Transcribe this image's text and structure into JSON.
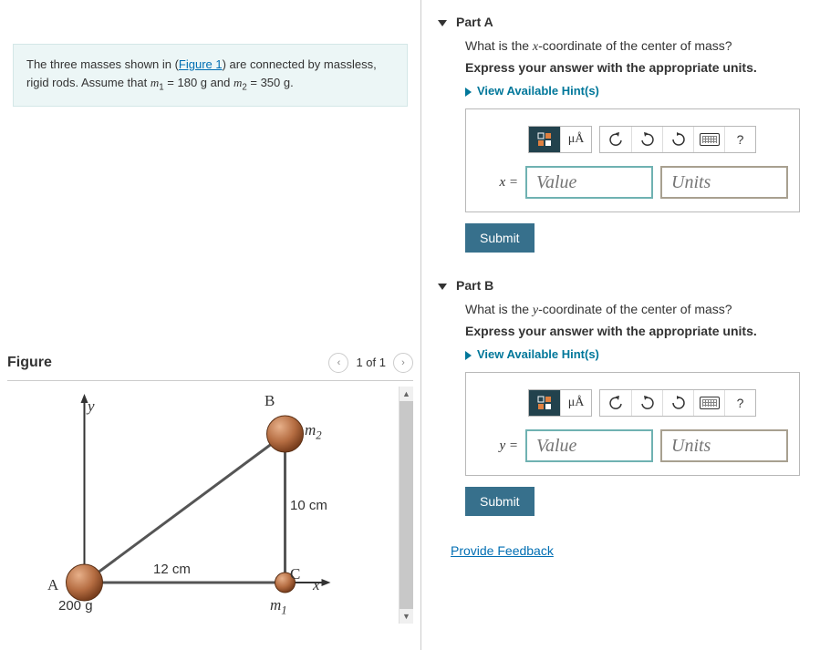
{
  "problem": {
    "prefix": "The three masses shown in (",
    "figureLink": "Figure 1",
    "middle": ") are connected by massless, rigid rods. Assume that ",
    "m1label": "m",
    "m1sub": "1",
    "m1eq": " = 180 g and ",
    "m2label": "m",
    "m2sub": "2",
    "m2eq": " = 350 g."
  },
  "figure": {
    "title": "Figure",
    "pager": "1 of 1",
    "labels": {
      "y": "y",
      "x": "x",
      "A": "A",
      "B": "B",
      "C": "C",
      "m1": "m",
      "m1sub": "1",
      "m2": "m",
      "m2sub": "2",
      "massA": "200 g",
      "sideAC": "12 cm",
      "sideBC": "10 cm"
    }
  },
  "partA": {
    "header": "Part A",
    "question": "What is the x-coordinate of the center of mass?",
    "instruction": "Express your answer with the appropriate units.",
    "hints": "View Available Hint(s)",
    "mu": "μÅ",
    "help": "?",
    "varLabel": "x =",
    "valuePlaceholder": "Value",
    "unitsPlaceholder": "Units",
    "submit": "Submit"
  },
  "partB": {
    "header": "Part B",
    "question": "What is the y-coordinate of the center of mass?",
    "instruction": "Express your answer with the appropriate units.",
    "hints": "View Available Hint(s)",
    "mu": "μÅ",
    "help": "?",
    "varLabel": "y =",
    "valuePlaceholder": "Value",
    "unitsPlaceholder": "Units",
    "submit": "Submit"
  },
  "feedback": "Provide Feedback"
}
